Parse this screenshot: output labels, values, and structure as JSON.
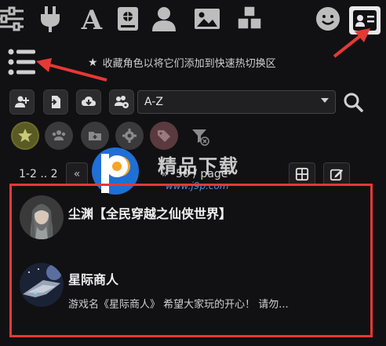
{
  "top_tabs": [
    {
      "name": "sliders-icon"
    },
    {
      "name": "plug-icon"
    },
    {
      "name": "font-icon"
    },
    {
      "name": "book-icon"
    },
    {
      "name": "user-icon"
    },
    {
      "name": "image-icon"
    },
    {
      "name": "cubes-icon"
    },
    {
      "name": "smile-icon"
    },
    {
      "name": "character-card-icon",
      "active": true
    }
  ],
  "favorites_hint": "收藏角色以将它们添加到快速热切换区",
  "sort_select": {
    "value": "A-Z"
  },
  "pagination": {
    "range": "1-2 .. 2",
    "per_page_label": "50 / page"
  },
  "characters": [
    {
      "name": "尘渊【全民穿越之仙侠世界】",
      "description": ""
    },
    {
      "name": "星际商人",
      "description": "游戏名《星际商人》 希望大家玩的开心！ 请勿..."
    }
  ],
  "watermark": {
    "title": "精品下载",
    "url": "www.j9p.com"
  },
  "colors": {
    "accent_red": "#e53935",
    "favorite_on": "#6c6c2a"
  }
}
